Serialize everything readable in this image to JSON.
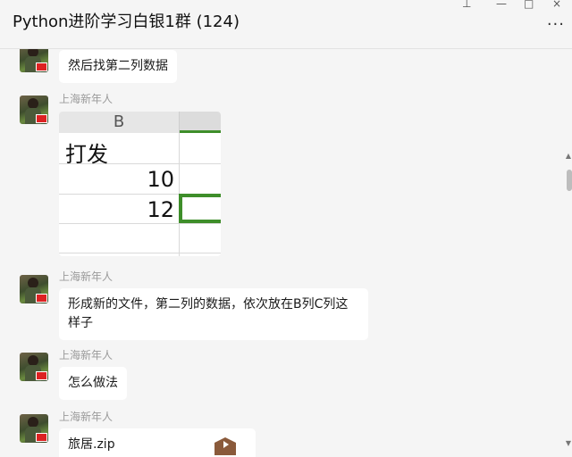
{
  "window": {
    "title": "Python进阶学习白银1群 (124)",
    "controls": {
      "pin": "⊥",
      "minimize": "—",
      "maximize": "□",
      "close": "×"
    },
    "more_label": "···"
  },
  "messages": [
    {
      "type": "text",
      "sender": "",
      "text": "然后找第二列数据"
    },
    {
      "type": "image",
      "sender": "上海新年人",
      "spreadsheet": {
        "column_header": "B",
        "cells": [
          "打发",
          "10",
          "12",
          ""
        ]
      }
    },
    {
      "type": "text",
      "sender": "上海新年人",
      "lines": [
        "形成新的文件，第二列的数据，依次放在B列C列这",
        "样子"
      ]
    },
    {
      "type": "text",
      "sender": "上海新年人",
      "text": "怎么做法"
    },
    {
      "type": "file",
      "sender": "上海新年人",
      "file_name": "旅居.zip",
      "icon": "zip-file-icon"
    }
  ],
  "colors": {
    "selection": "#3e8e2a",
    "bubble": "#ffffff",
    "background": "#f5f5f5"
  }
}
